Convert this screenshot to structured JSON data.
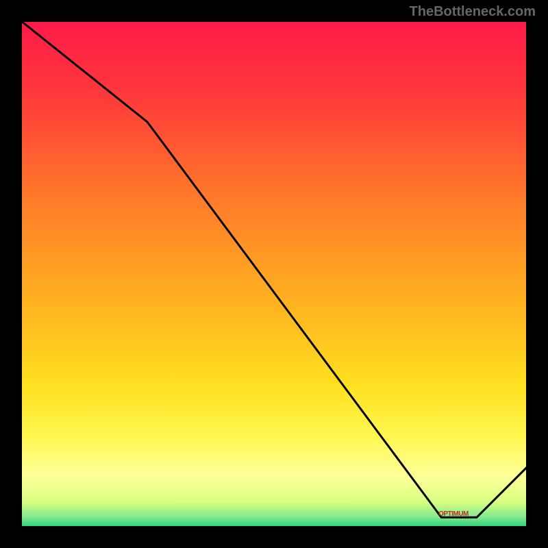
{
  "watermark": "TheBottleneck.com",
  "red_label": "OPTIMUM",
  "chart_data": {
    "type": "line",
    "title": "",
    "xlabel": "",
    "ylabel": "",
    "xlim": [
      0,
      100
    ],
    "ylim": [
      0,
      100
    ],
    "series": [
      {
        "name": "curve",
        "x": [
          0,
          25,
          83,
          90,
          100
        ],
        "values": [
          100,
          80,
          2,
          2,
          12
        ]
      }
    ],
    "gradient_stops": [
      {
        "pos": 0.0,
        "color": "#ff1a4a"
      },
      {
        "pos": 0.15,
        "color": "#ff3a3a"
      },
      {
        "pos": 0.35,
        "color": "#ff7a2a"
      },
      {
        "pos": 0.55,
        "color": "#ffb020"
      },
      {
        "pos": 0.72,
        "color": "#ffe020"
      },
      {
        "pos": 0.82,
        "color": "#fff850"
      },
      {
        "pos": 0.9,
        "color": "#feff9a"
      },
      {
        "pos": 0.95,
        "color": "#d8ff80"
      },
      {
        "pos": 0.98,
        "color": "#80e890"
      },
      {
        "pos": 1.0,
        "color": "#20d078"
      }
    ],
    "optimum_x_range": [
      83,
      90
    ]
  }
}
